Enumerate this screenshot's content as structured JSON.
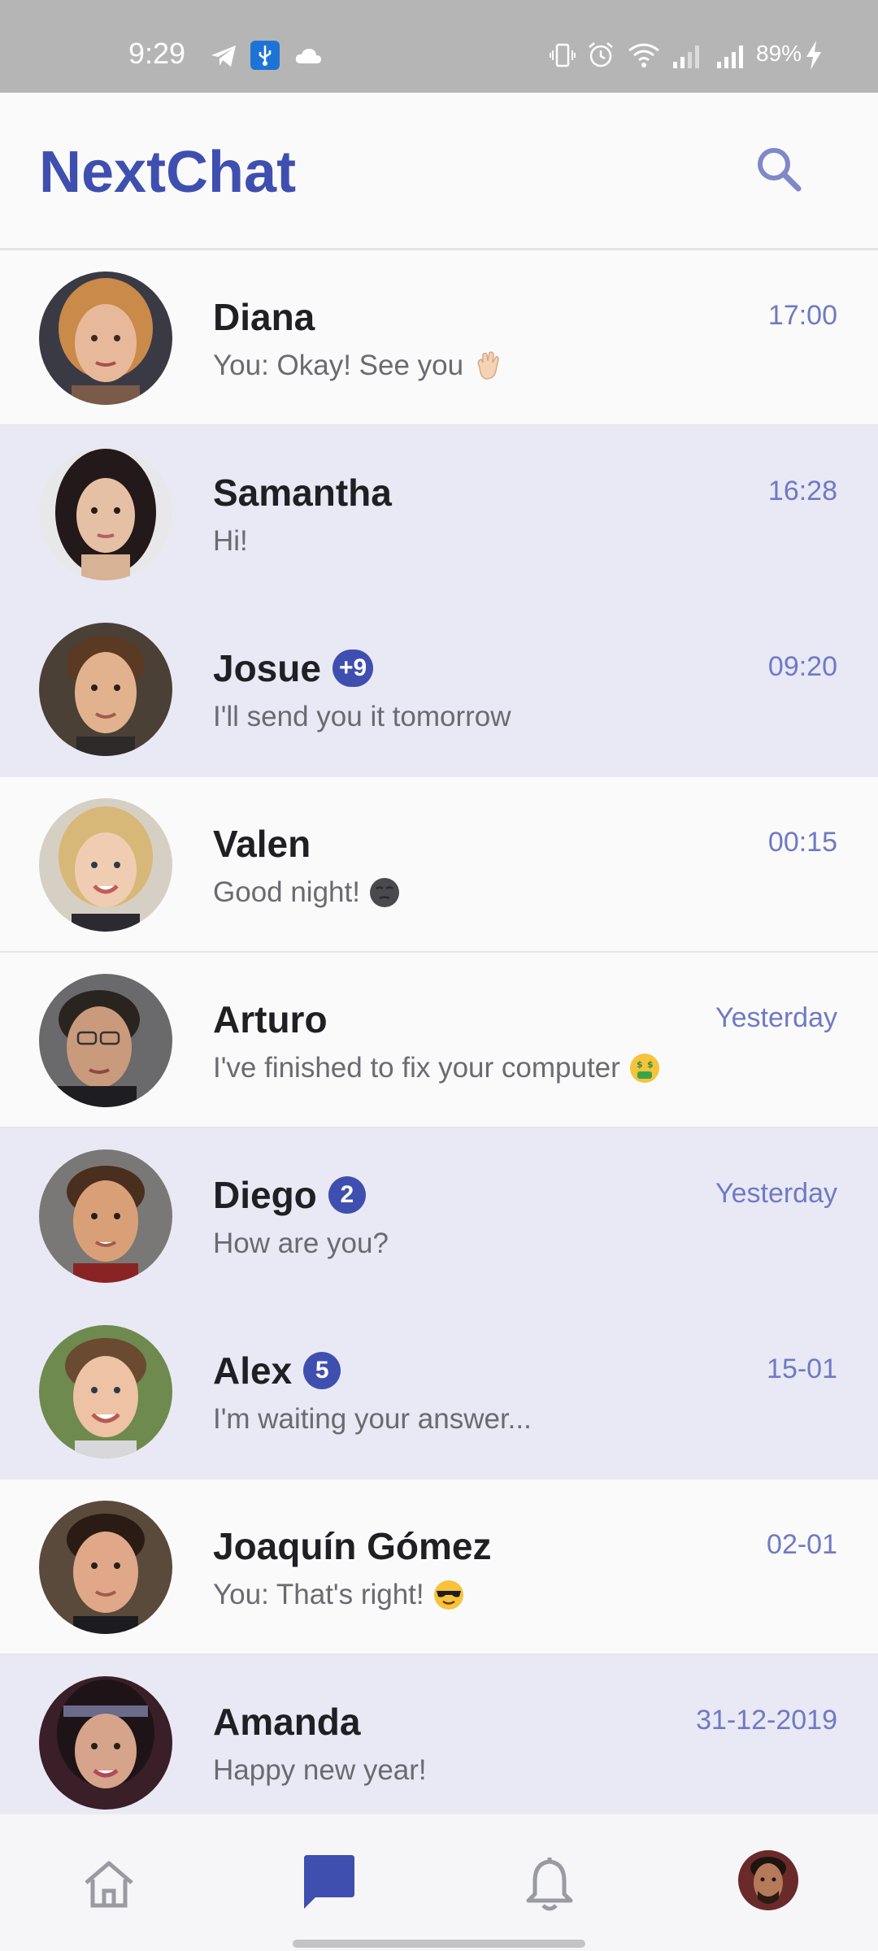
{
  "status_bar": {
    "time": "9:29",
    "battery": "89%",
    "icons": [
      "telegram-icon",
      "usb-debug-icon",
      "cloud-icon",
      "vibrate-icon",
      "alarm-icon",
      "wifi-icon",
      "signal-icon",
      "signal-icon",
      "charging-icon"
    ]
  },
  "header": {
    "title": "NextChat",
    "search_icon": "search-icon"
  },
  "colors": {
    "accent": "#3f4fb0",
    "time": "#6f7ac4",
    "unread_row": "#e9e9f5",
    "read_row": "#fafafa"
  },
  "chats": [
    {
      "name": "Diana",
      "preview": "You: Okay! See you",
      "emoji": "waving-hand",
      "time": "17:00",
      "badge": "",
      "unread": false
    },
    {
      "name": "Samantha",
      "preview": "Hi!",
      "emoji": "",
      "time": "16:28",
      "badge": "",
      "unread": true
    },
    {
      "name": "Josue",
      "preview": "I'll send you it tomorrow",
      "emoji": "",
      "time": "09:20",
      "badge": "+9",
      "unread": true
    },
    {
      "name": "Valen",
      "preview": "Good night!",
      "emoji": "new-moon-face",
      "time": "00:15",
      "badge": "",
      "unread": false
    },
    {
      "name": "Arturo",
      "preview": "I've finished to fix your computer",
      "emoji": "money-mouth-face",
      "time": "Yesterday",
      "badge": "",
      "unread": false
    },
    {
      "name": "Diego",
      "preview": "How are you?",
      "emoji": "",
      "time": "Yesterday",
      "badge": "2",
      "unread": true
    },
    {
      "name": "Alex",
      "preview": "I'm waiting your answer...",
      "emoji": "",
      "time": "15-01",
      "badge": "5",
      "unread": true
    },
    {
      "name": "Joaquín Gómez",
      "preview": "You: That's right!",
      "emoji": "sunglasses-face",
      "time": "02-01",
      "badge": "",
      "unread": false
    },
    {
      "name": "Amanda",
      "preview": "Happy new year!",
      "emoji": "",
      "time": "31-12-2019",
      "badge": "",
      "unread": true
    }
  ],
  "bottom_nav": {
    "items": [
      "home-icon",
      "chat-icon",
      "bell-icon",
      "profile-avatar"
    ],
    "active": "chat-icon"
  }
}
